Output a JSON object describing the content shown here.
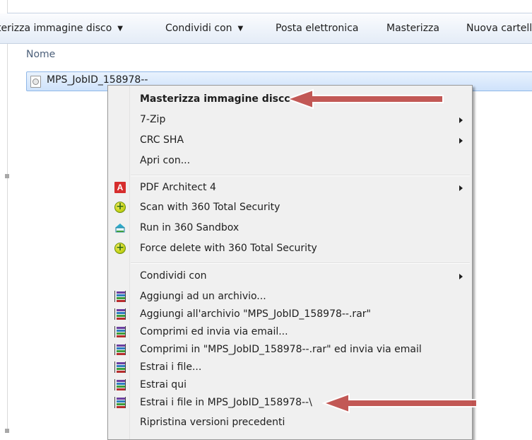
{
  "toolbar": {
    "items": [
      {
        "label": "terizza immagine disco",
        "dropdown": true
      },
      {
        "label": "Condividi con",
        "dropdown": true
      },
      {
        "label": "Posta elettronica",
        "dropdown": false
      },
      {
        "label": "Masterizza",
        "dropdown": false
      },
      {
        "label": "Nuova cartell",
        "dropdown": false
      }
    ]
  },
  "file_list": {
    "column_header": "Nome",
    "selected_file": {
      "name": "MPS_JobID_158978--",
      "icon": "disc-image-file-icon"
    }
  },
  "context_menu": {
    "items": [
      {
        "label": "Masterizza immagine disco",
        "bold": true,
        "icon": null,
        "submenu": false
      },
      {
        "label": "7-Zip",
        "bold": false,
        "icon": null,
        "submenu": true
      },
      {
        "label": "CRC SHA",
        "bold": false,
        "icon": null,
        "submenu": true
      },
      {
        "label": "Apri con...",
        "bold": false,
        "icon": null,
        "submenu": false
      },
      {
        "label": "PDF Architect 4",
        "bold": false,
        "icon": "pdf-architect-icon",
        "submenu": true
      },
      {
        "label": "Scan with 360 Total Security",
        "bold": false,
        "icon": "360-security-icon",
        "submenu": false
      },
      {
        "label": "Run in 360 Sandbox",
        "bold": false,
        "icon": "360-sandbox-icon",
        "submenu": false
      },
      {
        "label": "Force delete with 360 Total Security",
        "bold": false,
        "icon": "360-security-icon",
        "submenu": false
      },
      {
        "label": "Condividi con",
        "bold": false,
        "icon": null,
        "submenu": true
      },
      {
        "label": "Aggiungi ad un archivio...",
        "bold": false,
        "icon": "winrar-icon",
        "submenu": false
      },
      {
        "label": "Aggiungi all'archivio \"MPS_JobID_158978--.rar\"",
        "bold": false,
        "icon": "winrar-icon",
        "submenu": false
      },
      {
        "label": "Comprimi ed invia via email...",
        "bold": false,
        "icon": "winrar-icon",
        "submenu": false
      },
      {
        "label": "Comprimi in \"MPS_JobID_158978--.rar\" ed invia via email",
        "bold": false,
        "icon": "winrar-icon",
        "submenu": false
      },
      {
        "label": "Estrai i file...",
        "bold": false,
        "icon": "winrar-icon",
        "submenu": false
      },
      {
        "label": "Estrai qui",
        "bold": false,
        "icon": "winrar-icon",
        "submenu": false
      },
      {
        "label": "Estrai i file in MPS_JobID_158978--\\",
        "bold": false,
        "icon": "winrar-icon",
        "submenu": false
      },
      {
        "label": "Ripristina versioni precedenti",
        "bold": false,
        "icon": null,
        "submenu": false
      }
    ]
  },
  "colors": {
    "annotation_arrow": "#c0504d",
    "selection_border": "#8fb7e8",
    "menu_background": "#f0f0f0"
  }
}
